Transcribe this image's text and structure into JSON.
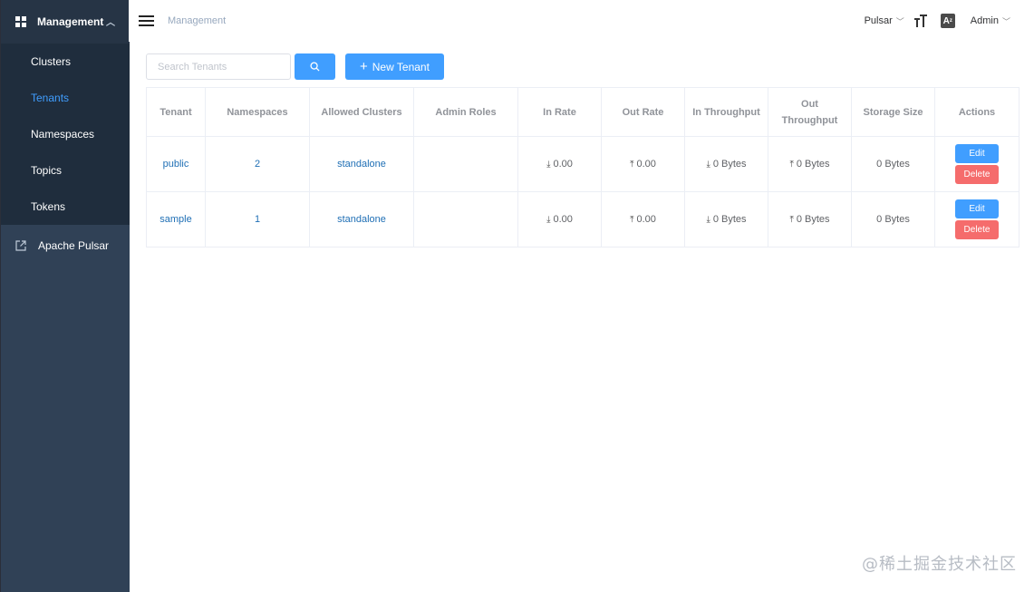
{
  "sidebar": {
    "management_label": "Management",
    "items": [
      {
        "label": "Clusters"
      },
      {
        "label": "Tenants"
      },
      {
        "label": "Namespaces"
      },
      {
        "label": "Topics"
      },
      {
        "label": "Tokens"
      }
    ],
    "active_item": "Tenants",
    "external_link_label": "Apache Pulsar"
  },
  "header": {
    "breadcrumb": "Management",
    "environment_label": "Pulsar",
    "user_label": "Admin"
  },
  "toolbar": {
    "search_placeholder": "Search Tenants",
    "search_value": "",
    "new_tenant_label": "New Tenant"
  },
  "table": {
    "columns": [
      "Tenant",
      "Namespaces",
      "Allowed Clusters",
      "Admin Roles",
      "In Rate",
      "Out Rate",
      "In Throughput",
      "Out Throughput",
      "Storage Size",
      "Actions"
    ],
    "rows": [
      {
        "tenant": "public",
        "namespaces": "2",
        "allowed_clusters": "standalone",
        "admin_roles": "",
        "in_rate": "0.00",
        "out_rate": "0.00",
        "in_throughput": "0 Bytes",
        "out_throughput": "0 Bytes",
        "storage_size": "0 Bytes"
      },
      {
        "tenant": "sample",
        "namespaces": "1",
        "allowed_clusters": "standalone",
        "admin_roles": "",
        "in_rate": "0.00",
        "out_rate": "0.00",
        "in_throughput": "0 Bytes",
        "out_throughput": "0 Bytes",
        "storage_size": "0 Bytes"
      }
    ],
    "edit_label": "Edit",
    "delete_label": "Delete"
  },
  "watermark": "@稀土掘金技术社区",
  "icons": {
    "menu": "hamburger-icon",
    "management": "grid-icon",
    "external": "external-link-icon",
    "search": "search-icon",
    "font_size": "font-size-icon",
    "language": "translate-icon",
    "download": "download-arrow-icon",
    "upload": "upload-arrow-icon"
  },
  "colors": {
    "sidebar_bg": "#304156",
    "submenu_bg": "#1f2d3d",
    "active": "#409eff",
    "primary": "#409eff",
    "danger": "#f56c6c",
    "link": "#1f6fb5"
  }
}
